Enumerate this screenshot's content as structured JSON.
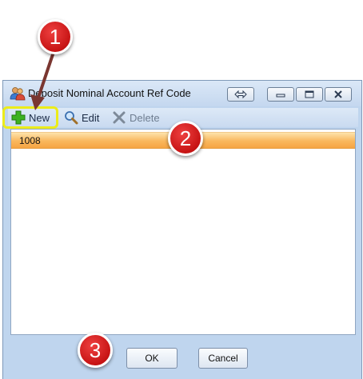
{
  "window": {
    "title": "Deposit Nominal Account Ref Code",
    "icon": "users-icon"
  },
  "toolbar": {
    "new_label": "New",
    "edit_label": "Edit",
    "delete_label": "Delete"
  },
  "list": {
    "rows": [
      {
        "code": "1008",
        "selected": true
      }
    ]
  },
  "buttons": {
    "ok_label": "OK",
    "cancel_label": "Cancel"
  },
  "callouts": {
    "one": "1",
    "two": "2",
    "three": "3"
  },
  "colors": {
    "highlight": "#ecec1a",
    "callout": "#d21a1a",
    "selected_row": "#f9b75d"
  }
}
